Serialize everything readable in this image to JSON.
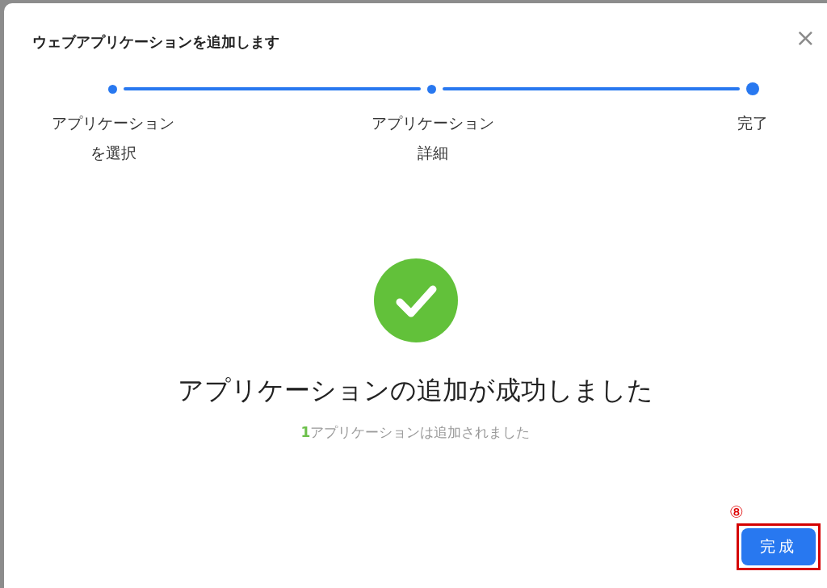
{
  "dialog": {
    "title": "ウェブアプリケーションを追加します",
    "close": "×"
  },
  "steps": [
    {
      "label": "アプリケーションを選択",
      "current": false
    },
    {
      "label": "アプリケーション詳細",
      "current": false
    },
    {
      "label": "完了",
      "current": true
    }
  ],
  "result": {
    "headline": "アプリケーションの追加が成功しました",
    "count": "1",
    "message": "アプリケーションは追加されました"
  },
  "footer": {
    "button": "完成",
    "callout": "⑧"
  }
}
